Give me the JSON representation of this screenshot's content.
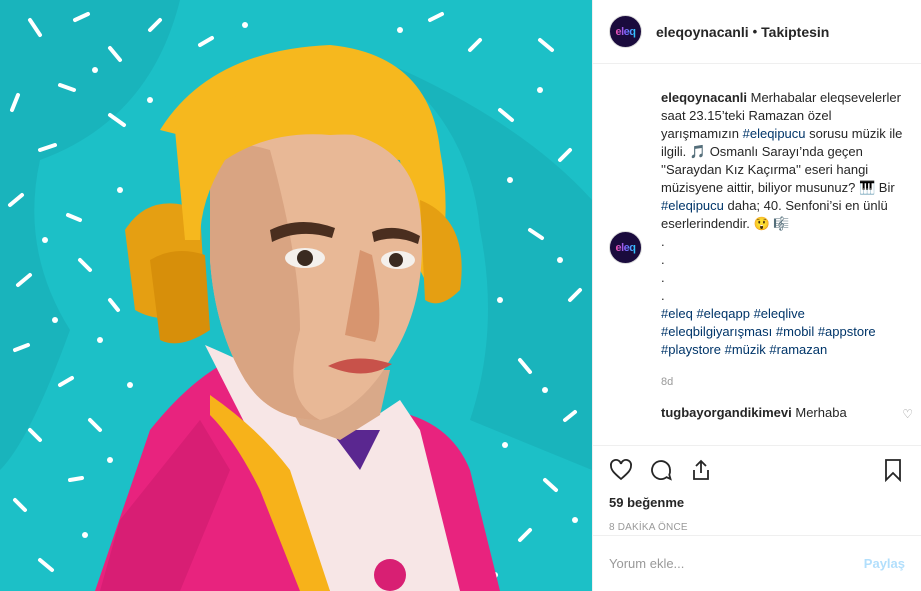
{
  "header": {
    "username": "eleqoynacanli",
    "separator": "•",
    "follow_status": "Takiptesin"
  },
  "avatar": {
    "logo_text": "eleq"
  },
  "caption": {
    "username": "eleqoynacanli",
    "text_1": "Merhabalar eleqsevelerler saat 23.15’teki Ramazan özel yarışmamızın ",
    "tag_1": "#eleqipucu",
    "text_2": " sorusu müzik ile ilgili. 🎵 Osmanlı Sarayı’nda geçen ''Saraydan Kız Kaçırma'' eseri hangi müzisyene aittir, biliyor musunuz? 🎹 Bir ",
    "tag_2": "#eleqipucu",
    "text_3": " daha; 40. Senfoni’si en ünlü eserlerindendir. 😲 ",
    "emoji_end": "🎼",
    "dots": [
      ".",
      ".",
      ".",
      "."
    ],
    "hashtags_line1": [
      "#eleq",
      "#eleqapp",
      "#eleqlive"
    ],
    "hashtags_line2": [
      "#eleqbilgiyarışması",
      "#mobil",
      "#appstore"
    ],
    "hashtags_line3": [
      "#playstore",
      "#müzik",
      "#ramazan"
    ],
    "time": "8d"
  },
  "comment": {
    "username": "tugbayorgandikimevi",
    "text": "Merhaba"
  },
  "actions": {
    "likes": "59 beğenme",
    "time_ago": "8 DAKİKA ÖNCE"
  },
  "add_comment": {
    "placeholder": "Yorum ekle...",
    "post_label": "Paylaş"
  },
  "colors": {
    "background": "#1cc0c7",
    "hair": "#f6b81e",
    "coat": "#e8237e",
    "hashtag": "#003569",
    "post_button": "#b2dffc"
  }
}
